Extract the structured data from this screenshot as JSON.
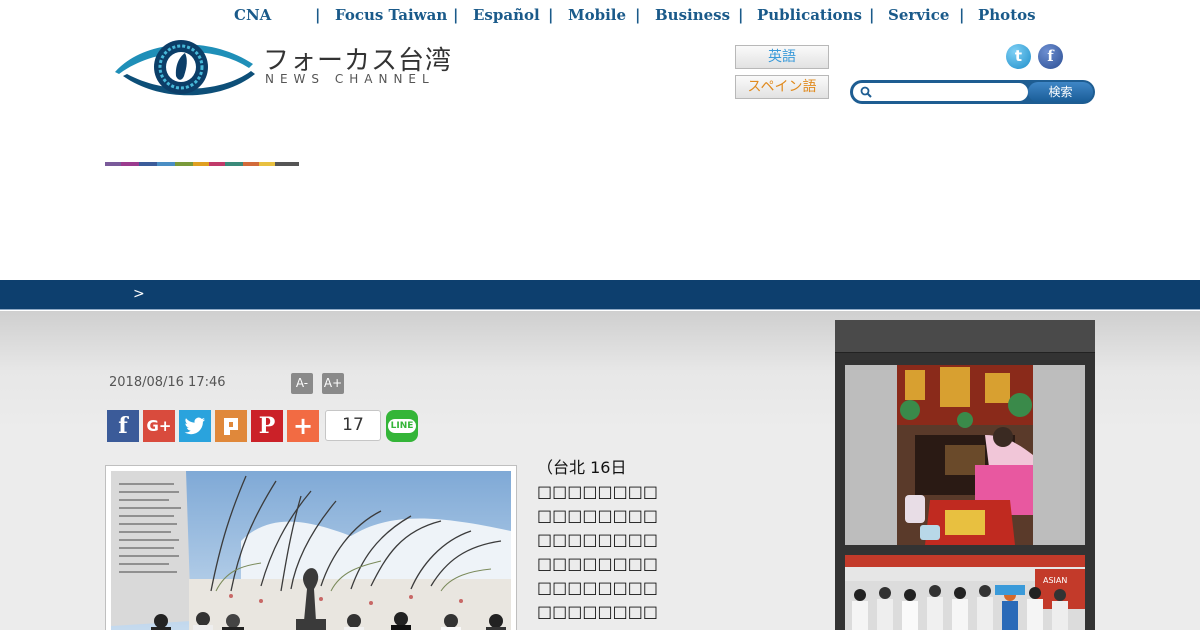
{
  "topnav": {
    "items": [
      "CNA",
      "Focus Taiwan",
      "Español",
      "Mobile",
      "Business",
      "Publications",
      "Service",
      "Photos"
    ],
    "separator": "|"
  },
  "logo": {
    "name_jp": "フォーカス台湾",
    "name_en": "NEWS CHANNEL"
  },
  "language": {
    "english": "英語",
    "spanish": "スペイン語"
  },
  "social": {
    "twitter": "t",
    "facebook": "f"
  },
  "search": {
    "button": "検索",
    "placeholder": ""
  },
  "colorbar": [
    "#7a5a9a",
    "#9b3b8e",
    "#3b5c9a",
    "#4a8ec4",
    "#7a9a3a",
    "#e0a020",
    "#c03a6a",
    "#3a8a7a",
    "#d26a3a",
    "#e8c040",
    "#555555"
  ],
  "breadcrumb": {
    "arrow": ">"
  },
  "article": {
    "date": "2018/08/16 17:46",
    "font_smaller": "A-",
    "font_larger": "A+",
    "share_count": "17",
    "line_label": "LINE",
    "text_lines": [
      "（台北 16日",
      "□□□□□□□□",
      "□□□□□□□□",
      "□□□□□□□□",
      "□□□□□□□□",
      "□□□□□□□□",
      "□□□□□□□□",
      "□□□□□□□□"
    ]
  },
  "sidebar": {
    "thumb2_banner": "ASIAN"
  },
  "colors": {
    "nav_link": "#1a5a8a",
    "breadcrumb_bar": "#0d3f6e",
    "search_bar": "#1e5d92"
  }
}
